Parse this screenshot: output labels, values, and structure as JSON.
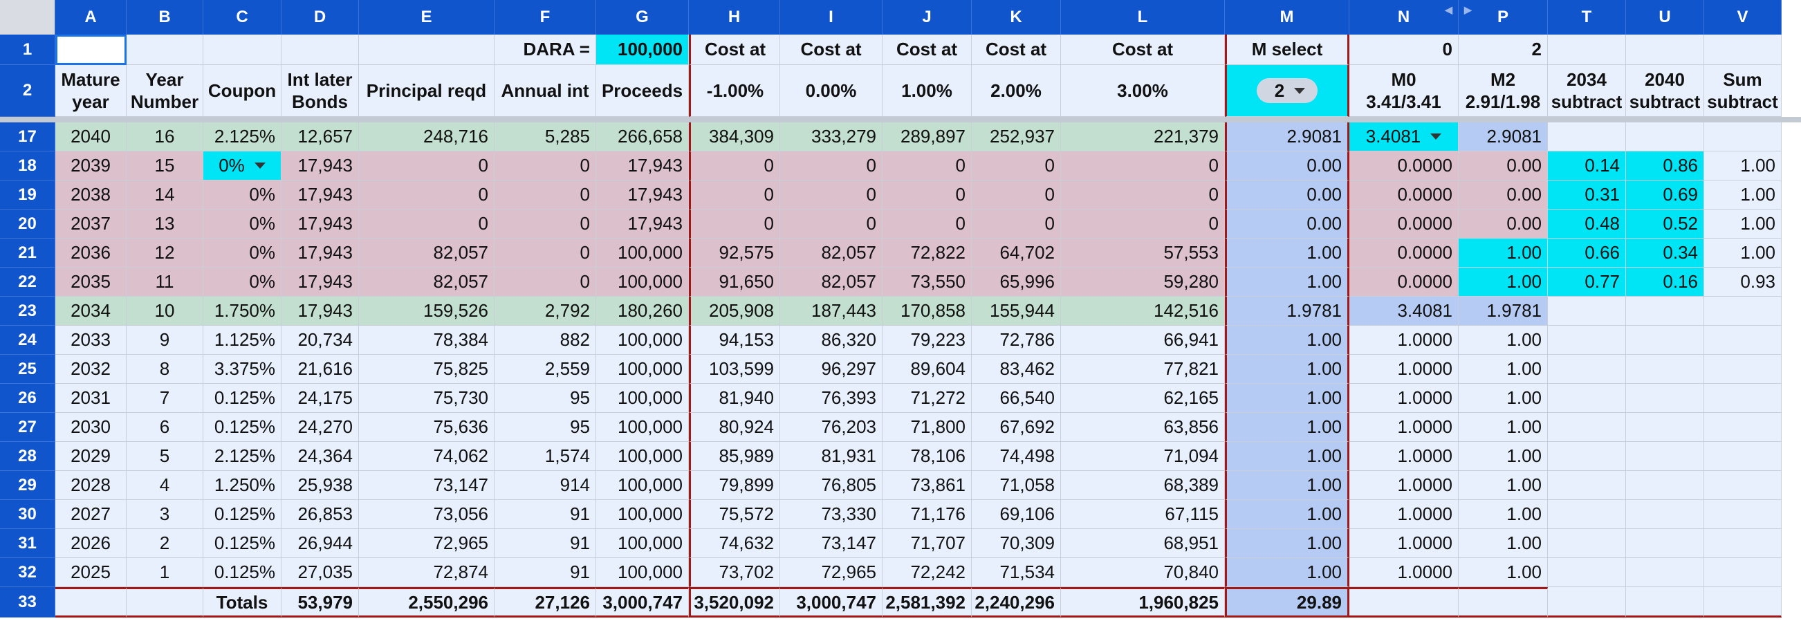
{
  "columns": [
    "A",
    "B",
    "C",
    "D",
    "E",
    "F",
    "G",
    "H",
    "I",
    "J",
    "K",
    "L",
    "M",
    "N",
    "P",
    "T",
    "U",
    "V"
  ],
  "row1": {
    "num": "1",
    "dara_label": "DARA =",
    "dara_value": "100,000",
    "cost_at": [
      "Cost at",
      "Cost at",
      "Cost at",
      "Cost at",
      "Cost at"
    ],
    "m_select": "M select",
    "n_val": "0",
    "p_val": "2"
  },
  "row2": {
    "num": "2",
    "headers": [
      [
        "Mature",
        "year"
      ],
      [
        "Year",
        "Number"
      ],
      [
        "",
        "Coupon"
      ],
      [
        "Int later",
        "Bonds"
      ],
      [
        "",
        "Principal reqd"
      ],
      [
        "",
        "Annual int"
      ],
      [
        "",
        "Proceeds"
      ],
      [
        "",
        "-1.00%"
      ],
      [
        "",
        "0.00%"
      ],
      [
        "",
        "1.00%"
      ],
      [
        "",
        "2.00%"
      ],
      [
        "",
        "3.00%"
      ],
      [
        "",
        ""
      ],
      [
        "M0",
        "3.41/3.41"
      ],
      [
        "M2",
        "2.91/1.98"
      ],
      [
        "2034",
        "subtract"
      ],
      [
        "2040",
        "subtract"
      ],
      [
        "Sum",
        "subtract"
      ]
    ],
    "m_dropdown": "2"
  },
  "rows": [
    {
      "num": "17",
      "style": "green",
      "cells": [
        "2040",
        "16",
        "2.125%",
        "12,657",
        "248,716",
        "5,285",
        "266,658",
        "384,309",
        "333,279",
        "289,897",
        "252,937",
        "221,379",
        "2.9081",
        "3.4081",
        "2.9081",
        "",
        "",
        ""
      ]
    },
    {
      "num": "18",
      "style": "pink",
      "cells": [
        "2039",
        "15",
        "0%",
        "17,943",
        "0",
        "0",
        "17,943",
        "0",
        "0",
        "0",
        "0",
        "0",
        "0.00",
        "0.0000",
        "0.00",
        "0.14",
        "0.86",
        "1.00"
      ]
    },
    {
      "num": "19",
      "style": "pink",
      "cells": [
        "2038",
        "14",
        "0%",
        "17,943",
        "0",
        "0",
        "17,943",
        "0",
        "0",
        "0",
        "0",
        "0",
        "0.00",
        "0.0000",
        "0.00",
        "0.31",
        "0.69",
        "1.00"
      ]
    },
    {
      "num": "20",
      "style": "pink",
      "cells": [
        "2037",
        "13",
        "0%",
        "17,943",
        "0",
        "0",
        "17,943",
        "0",
        "0",
        "0",
        "0",
        "0",
        "0.00",
        "0.0000",
        "0.00",
        "0.48",
        "0.52",
        "1.00"
      ]
    },
    {
      "num": "21",
      "style": "pink",
      "cells": [
        "2036",
        "12",
        "0%",
        "17,943",
        "82,057",
        "0",
        "100,000",
        "92,575",
        "82,057",
        "72,822",
        "64,702",
        "57,553",
        "1.00",
        "0.0000",
        "1.00",
        "0.66",
        "0.34",
        "1.00"
      ]
    },
    {
      "num": "22",
      "style": "pink",
      "cells": [
        "2035",
        "11",
        "0%",
        "17,943",
        "82,057",
        "0",
        "100,000",
        "91,650",
        "82,057",
        "73,550",
        "65,996",
        "59,280",
        "1.00",
        "0.0000",
        "1.00",
        "0.77",
        "0.16",
        "0.93"
      ]
    },
    {
      "num": "23",
      "style": "green",
      "cells": [
        "2034",
        "10",
        "1.750%",
        "17,943",
        "159,526",
        "2,792",
        "180,260",
        "205,908",
        "187,443",
        "170,858",
        "155,944",
        "142,516",
        "1.9781",
        "3.4081",
        "1.9781",
        "",
        "",
        ""
      ]
    },
    {
      "num": "24",
      "style": "def",
      "cells": [
        "2033",
        "9",
        "1.125%",
        "20,734",
        "78,384",
        "882",
        "100,000",
        "94,153",
        "86,320",
        "79,223",
        "72,786",
        "66,941",
        "1.00",
        "1.0000",
        "1.00",
        "",
        "",
        ""
      ]
    },
    {
      "num": "25",
      "style": "def",
      "cells": [
        "2032",
        "8",
        "3.375%",
        "21,616",
        "75,825",
        "2,559",
        "100,000",
        "103,599",
        "96,297",
        "89,604",
        "83,462",
        "77,821",
        "1.00",
        "1.0000",
        "1.00",
        "",
        "",
        ""
      ]
    },
    {
      "num": "26",
      "style": "def",
      "cells": [
        "2031",
        "7",
        "0.125%",
        "24,175",
        "75,730",
        "95",
        "100,000",
        "81,940",
        "76,393",
        "71,272",
        "66,540",
        "62,165",
        "1.00",
        "1.0000",
        "1.00",
        "",
        "",
        ""
      ]
    },
    {
      "num": "27",
      "style": "def",
      "cells": [
        "2030",
        "6",
        "0.125%",
        "24,270",
        "75,636",
        "95",
        "100,000",
        "80,924",
        "76,203",
        "71,800",
        "67,692",
        "63,856",
        "1.00",
        "1.0000",
        "1.00",
        "",
        "",
        ""
      ]
    },
    {
      "num": "28",
      "style": "def",
      "cells": [
        "2029",
        "5",
        "2.125%",
        "24,364",
        "74,062",
        "1,574",
        "100,000",
        "85,989",
        "81,931",
        "78,106",
        "74,498",
        "71,094",
        "1.00",
        "1.0000",
        "1.00",
        "",
        "",
        ""
      ]
    },
    {
      "num": "29",
      "style": "def",
      "cells": [
        "2028",
        "4",
        "1.250%",
        "25,938",
        "73,147",
        "914",
        "100,000",
        "79,899",
        "76,805",
        "73,861",
        "71,058",
        "68,389",
        "1.00",
        "1.0000",
        "1.00",
        "",
        "",
        ""
      ]
    },
    {
      "num": "30",
      "style": "def",
      "cells": [
        "2027",
        "3",
        "0.125%",
        "26,853",
        "73,056",
        "91",
        "100,000",
        "75,572",
        "73,330",
        "71,176",
        "69,106",
        "67,115",
        "1.00",
        "1.0000",
        "1.00",
        "",
        "",
        ""
      ]
    },
    {
      "num": "31",
      "style": "def",
      "cells": [
        "2026",
        "2",
        "0.125%",
        "26,944",
        "72,965",
        "91",
        "100,000",
        "74,632",
        "73,147",
        "71,707",
        "70,309",
        "68,951",
        "1.00",
        "1.0000",
        "1.00",
        "",
        "",
        ""
      ]
    },
    {
      "num": "32",
      "style": "def",
      "cells": [
        "2025",
        "1",
        "0.125%",
        "27,035",
        "72,874",
        "91",
        "100,000",
        "73,702",
        "72,965",
        "72,242",
        "71,534",
        "70,840",
        "1.00",
        "1.0000",
        "1.00",
        "",
        "",
        ""
      ]
    }
  ],
  "totals": {
    "num": "33",
    "cells": [
      "",
      "",
      "Totals",
      "53,979",
      "2,550,296",
      "27,126",
      "3,000,747",
      "3,520,092",
      "3,000,747",
      "2,581,392",
      "2,240,296",
      "1,960,825",
      "29.89",
      "",
      "",
      "",
      "",
      ""
    ]
  },
  "colors": {
    "header_blue": "#1155cc",
    "row_default": "#e8f0fe",
    "row_green": "#c3dfd0",
    "row_pink": "#dcc1cc",
    "col_m_blue": "#b5cbf3",
    "cyan": "#00e5f5",
    "border_red": "#a01818"
  }
}
